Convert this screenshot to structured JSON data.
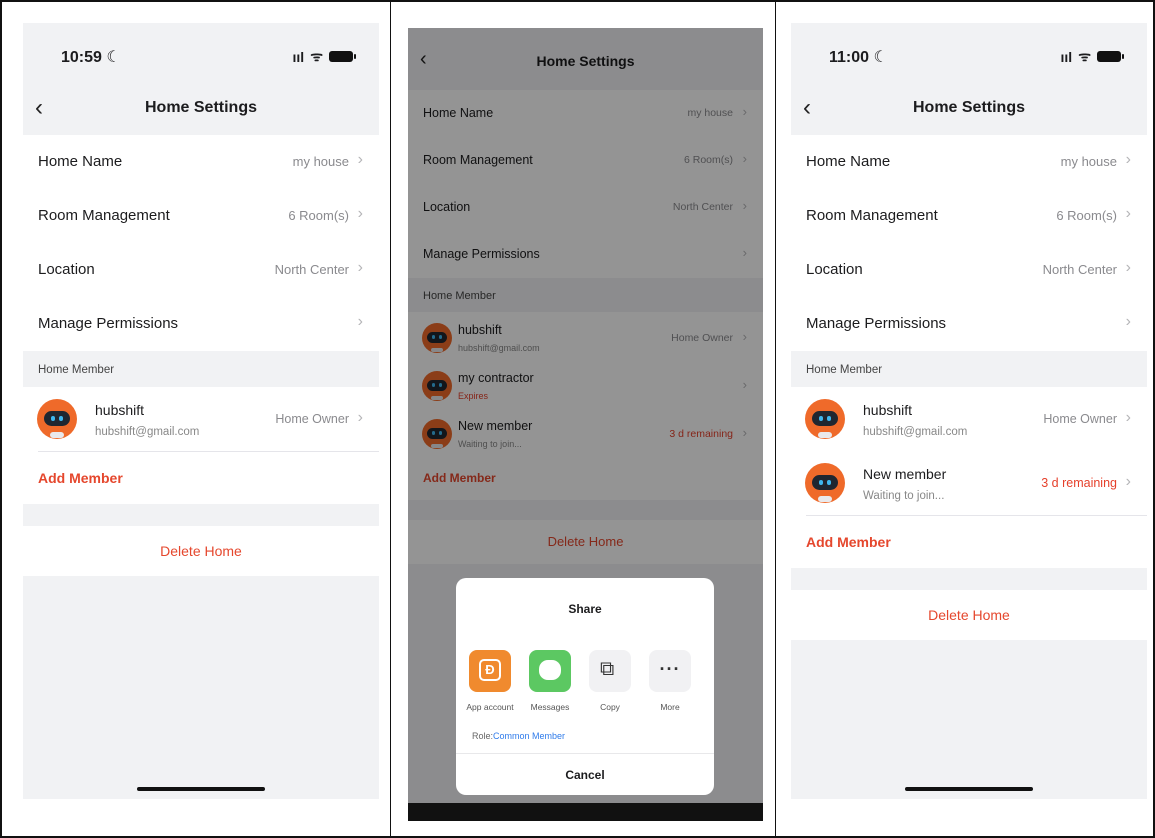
{
  "panels": [
    {
      "status": {
        "time": "10:59",
        "moon": "☾",
        "signal": "ııl",
        "wifi": "ᯤ"
      },
      "nav": {
        "back": "‹",
        "title": "Home Settings"
      },
      "settings": [
        {
          "label": "Home Name",
          "value": "my house"
        },
        {
          "label": "Room Management",
          "value": "6 Room(s)"
        },
        {
          "label": "Location",
          "value": "North Center"
        },
        {
          "label": "Manage Permissions",
          "value": ""
        }
      ],
      "member_header": "Home Member",
      "members": [
        {
          "name": "hubshift",
          "sub": "hubshift@gmail.com",
          "role": "Home Owner"
        }
      ],
      "add_member": "Add Member",
      "delete_home": "Delete Home"
    },
    {
      "nav": {
        "back": "‹",
        "title": "Home Settings"
      },
      "settings": [
        {
          "label": "Home Name",
          "value": "my house"
        },
        {
          "label": "Room Management",
          "value": "6 Room(s)"
        },
        {
          "label": "Location",
          "value": "North Center"
        },
        {
          "label": "Manage Permissions",
          "value": ""
        }
      ],
      "member_header": "Home Member",
      "members": [
        {
          "name": "hubshift",
          "sub": "hubshift@gmail.com",
          "role": "Home Owner"
        },
        {
          "name": "my contractor",
          "sub": "Expires",
          "role": ""
        },
        {
          "name": "New member",
          "sub": "Waiting to join...",
          "role": "3 d remaining"
        }
      ],
      "add_member": "Add Member",
      "delete_home": "Delete Home",
      "share_sheet": {
        "title": "Share",
        "options": [
          {
            "label": "App account",
            "icon": "app-account-icon",
            "glyph": "Ð"
          },
          {
            "label": "Messages",
            "icon": "messages-icon",
            "glyph": ""
          },
          {
            "label": "Copy",
            "icon": "copy-icon",
            "glyph": "⧉"
          },
          {
            "label": "More",
            "icon": "more-icon",
            "glyph": "···"
          }
        ],
        "role_prefix": "Role:",
        "role_value": "Common Member",
        "cancel": "Cancel"
      }
    },
    {
      "status": {
        "time": "11:00",
        "moon": "☾",
        "signal": "ııl",
        "wifi": "ᯤ"
      },
      "nav": {
        "back": "‹",
        "title": "Home Settings"
      },
      "settings": [
        {
          "label": "Home Name",
          "value": "my house"
        },
        {
          "label": "Room Management",
          "value": "6 Room(s)"
        },
        {
          "label": "Location",
          "value": "North Center"
        },
        {
          "label": "Manage Permissions",
          "value": ""
        }
      ],
      "member_header": "Home Member",
      "members": [
        {
          "name": "hubshift",
          "sub": "hubshift@gmail.com",
          "role": "Home Owner"
        },
        {
          "name": "New member",
          "sub": "Waiting to join...",
          "role": "3 d remaining"
        }
      ],
      "add_member": "Add Member",
      "delete_home": "Delete Home"
    }
  ],
  "colors": {
    "accent_red": "#e5472d",
    "link_blue": "#2f7bea",
    "avatar_orange": "#ef6a2a"
  }
}
